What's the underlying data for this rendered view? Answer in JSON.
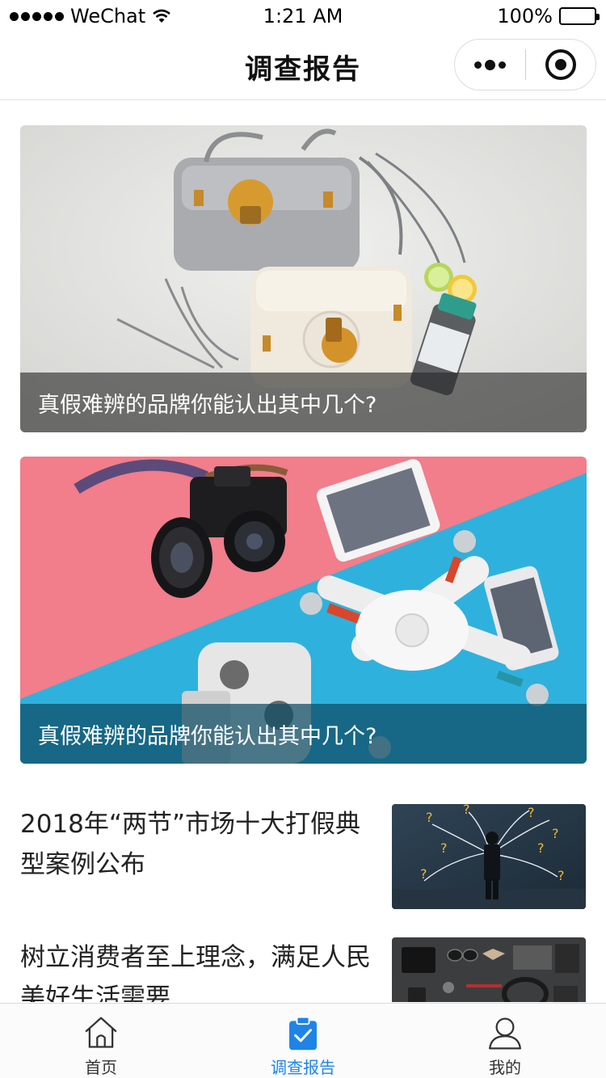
{
  "status_bar": {
    "carrier": "WeChat",
    "time": "1:21 AM",
    "battery": "100%"
  },
  "nav": {
    "title": "调查报告",
    "more_icon": "more-dots-icon",
    "close_icon": "target-circle-icon"
  },
  "featured": [
    {
      "caption": "真假难辨的品牌你能认出其中几个?",
      "image": "handbags-photo"
    },
    {
      "caption": "真假难辨的品牌你能认出其中几个?",
      "image": "drone-camera-photo"
    }
  ],
  "articles": [
    {
      "title": "2018年“两节”市场十大打假典型案例公布",
      "image": "businessman-question-marks-photo"
    },
    {
      "title": "树立消费者至上理念，满足人民美好生活需要",
      "image": "accessories-flatlay-photo"
    }
  ],
  "tabs": [
    {
      "label": "首页",
      "icon": "home-icon",
      "active": false
    },
    {
      "label": "调查报告",
      "icon": "clipboard-check-icon",
      "active": true
    },
    {
      "label": "我的",
      "icon": "user-icon",
      "active": false
    }
  ],
  "colors": {
    "accent": "#1e84e6",
    "tab_inactive": "#333333"
  }
}
